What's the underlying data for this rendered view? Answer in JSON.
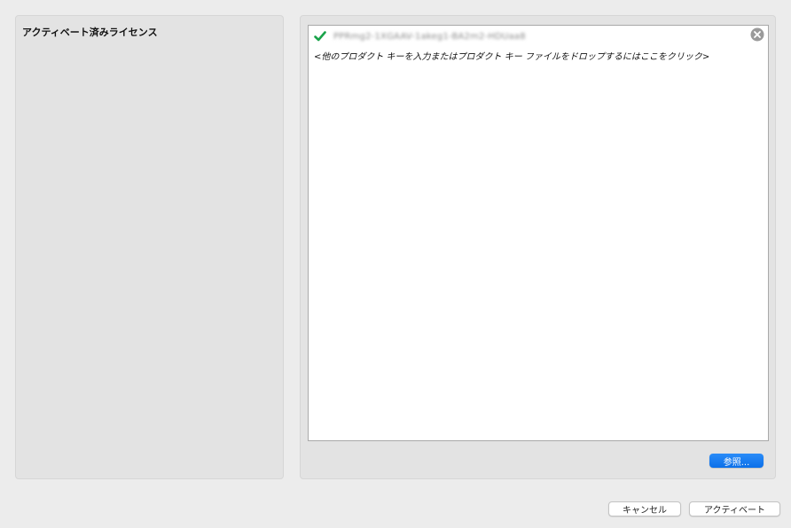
{
  "left_panel": {
    "title": "アクティベート済みライセンス"
  },
  "right_panel": {
    "license_entry": {
      "key": "PPRmg2-1XGAAV-1akeg1-BA2m2-HDUaa8",
      "status_icon": "check-icon",
      "remove_icon": "close-circle-icon"
    },
    "hint": "<他のプロダクト キーを入力またはプロダクト キー ファイルをドロップするにはここをクリック>",
    "browse_label": "参照..."
  },
  "footer": {
    "cancel_label": "キャンセル",
    "activate_label": "アクティベート"
  },
  "colors": {
    "accent": "#0b6fe9",
    "check": "#1aa34a",
    "background": "#ececec",
    "panel": "#e3e3e3"
  }
}
